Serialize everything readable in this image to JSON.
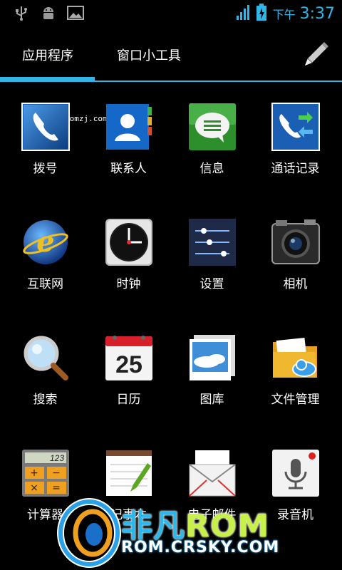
{
  "statusbar": {
    "icons": [
      "usb-icon",
      "android-debug-icon",
      "image-icon"
    ],
    "signal_icon": "signal-icon",
    "battery_icon": "battery-charging-icon",
    "ampm": "下午",
    "time": "3:37"
  },
  "tabs": {
    "apps": "应用程序",
    "widgets": "窗口小工具",
    "market_icon": "pencil-icon"
  },
  "apps": [
    {
      "label": "拨号",
      "icon": "phone-icon"
    },
    {
      "label": "联系人",
      "icon": "contacts-icon"
    },
    {
      "label": "信息",
      "icon": "messaging-icon"
    },
    {
      "label": "通话记录",
      "icon": "call-log-icon"
    },
    {
      "label": "互联网",
      "icon": "browser-icon"
    },
    {
      "label": "时钟",
      "icon": "clock-icon"
    },
    {
      "label": "设置",
      "icon": "settings-icon"
    },
    {
      "label": "相机",
      "icon": "camera-icon"
    },
    {
      "label": "搜索",
      "icon": "search-icon"
    },
    {
      "label": "日历",
      "icon": "calendar-icon"
    },
    {
      "label": "图库",
      "icon": "gallery-icon"
    },
    {
      "label": "文件管理",
      "icon": "file-manager-icon"
    },
    {
      "label": "计算器",
      "icon": "calculator-icon"
    },
    {
      "label": "记事本",
      "icon": "notepad-icon"
    },
    {
      "label": "电子邮件",
      "icon": "email-icon"
    },
    {
      "label": "录音机",
      "icon": "recorder-icon"
    }
  ],
  "calendar_day": "25",
  "calculator_display": "123",
  "watermark": {
    "small": "romzj.com",
    "brand_cn": "非凡",
    "brand_rom": "ROM",
    "url": "ROM.CRSKY.COM"
  },
  "colors": {
    "accent": "#33b5e5",
    "background": "#000000"
  }
}
